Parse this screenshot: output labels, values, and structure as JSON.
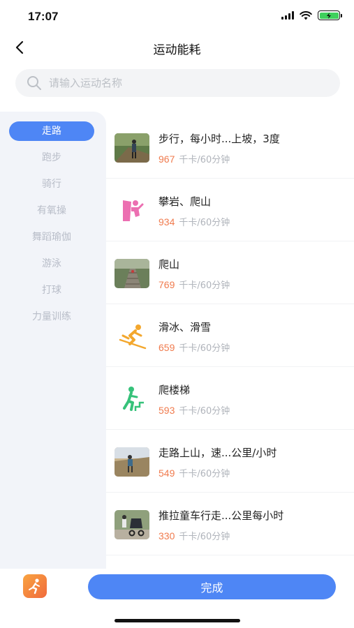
{
  "status": {
    "time": "17:07"
  },
  "nav": {
    "title": "运动能耗"
  },
  "search": {
    "placeholder": "请输入运动名称",
    "value": ""
  },
  "categories": [
    {
      "label": "走路",
      "active": true
    },
    {
      "label": "跑步"
    },
    {
      "label": "骑行"
    },
    {
      "label": "有氧操"
    },
    {
      "label": "舞蹈瑜伽"
    },
    {
      "label": "游泳"
    },
    {
      "label": "打球"
    },
    {
      "label": "力量训练"
    }
  ],
  "unit": "千卡/60分钟",
  "activities": [
    {
      "name": "步行，每小时...上坡，3度",
      "kcal": "967",
      "icon": "hiking-photo"
    },
    {
      "name": "攀岩、爬山",
      "kcal": "934",
      "icon": "rock-climbing-icon"
    },
    {
      "name": "爬山",
      "kcal": "769",
      "icon": "mountain-stairs-photo"
    },
    {
      "name": "滑冰、滑雪",
      "kcal": "659",
      "icon": "skiing-icon"
    },
    {
      "name": "爬楼梯",
      "kcal": "593",
      "icon": "stairs-climbing-icon"
    },
    {
      "name": "走路上山，速...公里/小时",
      "kcal": "549",
      "icon": "uphill-walk-photo"
    },
    {
      "name": "推拉童车行走...公里每小时",
      "kcal": "330",
      "icon": "stroller-photo"
    }
  ],
  "footer": {
    "done_label": "完成"
  },
  "colors": {
    "accent": "#4e86f5",
    "kcal": "#f07b4e",
    "sidebar_bg": "#f2f4f9"
  }
}
